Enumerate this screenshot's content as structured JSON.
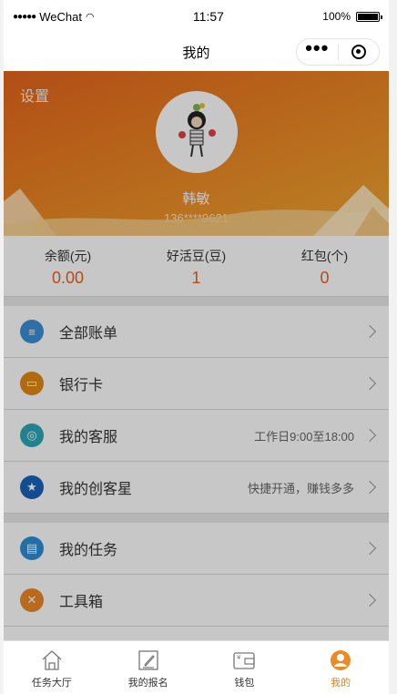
{
  "status": {
    "carrier": "WeChat",
    "time": "11:57",
    "battery": "100%"
  },
  "nav": {
    "title": "我的"
  },
  "header": {
    "settings": "设置",
    "username": "韩敏",
    "phone": "136****9621"
  },
  "stats": [
    {
      "label": "余额(元)",
      "value": "0.00"
    },
    {
      "label": "好活豆(豆)",
      "value": "1"
    },
    {
      "label": "红包(个)",
      "value": "0"
    }
  ],
  "menu": [
    {
      "label": "全部账单",
      "hint": "",
      "icon": "bill-icon",
      "color": "#3a8fd6"
    },
    {
      "label": "银行卡",
      "hint": "",
      "icon": "bank-card-icon",
      "color": "#e08a12"
    },
    {
      "label": "我的客服",
      "hint": "工作日9:00至18:00",
      "icon": "headset-icon",
      "color": "#2aa8b8"
    },
    {
      "label": "我的创客星",
      "hint": "快捷开通，赚钱多多",
      "icon": "star-person-icon",
      "color": "#1a63b8"
    },
    {
      "label": "我的任务",
      "hint": "",
      "icon": "task-icon",
      "color": "#2c8fd8"
    },
    {
      "label": "工具箱",
      "hint": "",
      "icon": "toolbox-icon",
      "color": "#ec8a25"
    }
  ],
  "tabs": [
    {
      "label": "任务大厅",
      "icon": "home-icon"
    },
    {
      "label": "我的报名",
      "icon": "edit-icon"
    },
    {
      "label": "钱包",
      "icon": "wallet-icon"
    },
    {
      "label": "我的",
      "icon": "user-icon"
    }
  ],
  "colors": {
    "accent": "#e5641c",
    "active_tab": "#e5821c"
  }
}
